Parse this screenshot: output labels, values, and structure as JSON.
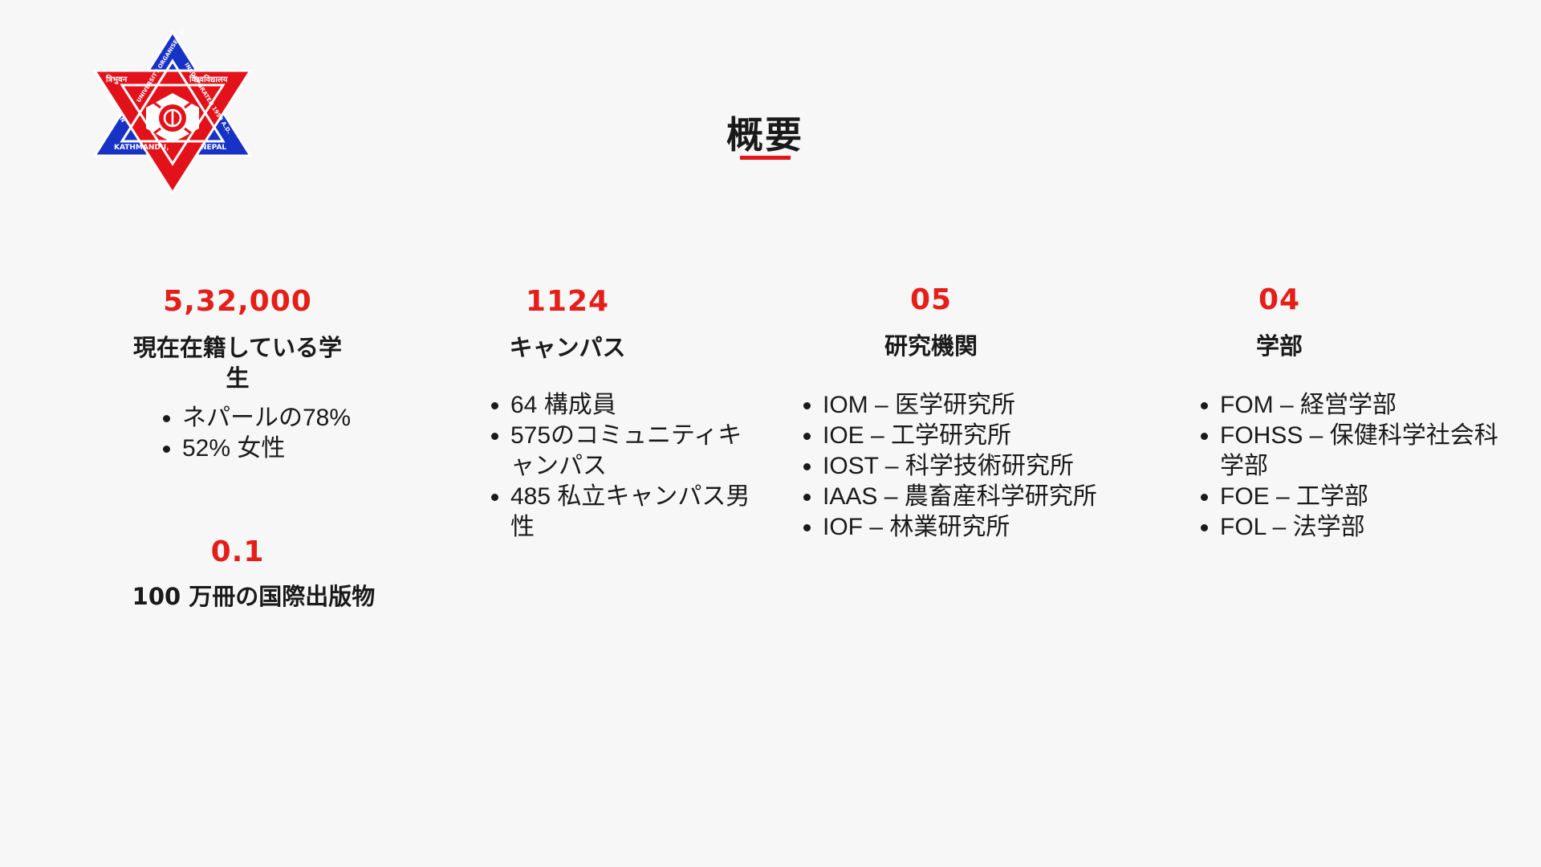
{
  "page": {
    "title": "概要"
  },
  "logo": {
    "name": "Tribhuvan University emblem",
    "text_top_left": "त्रिभुवन",
    "text_top_right": "विश्वविद्यालय",
    "text_bottom_left": "KATHMANDU,",
    "text_bottom_right": "NEPAL",
    "text_band_1": "UNIVERSITY ORGANISED 1959 A.D.",
    "text_band_2": "INCORPORATED 1959 A.D.",
    "text_band_3": "TRIBHUVAN",
    "colors": {
      "red": "#e3121a",
      "blue": "#1733c6",
      "white": "#ffffff"
    }
  },
  "stats": [
    {
      "value": "5,32,000",
      "label_line1": "現在在籍している学",
      "label_line2": "生",
      "items": [
        "ネパールの78%",
        "52% 女性"
      ]
    },
    {
      "value": "1124",
      "label": "キャンパス",
      "items": [
        "64 構成員",
        "575のコミュニティキ",
        "ャンパス",
        "485 私立キャンパス男",
        "性"
      ]
    },
    {
      "value": "05",
      "label": "研究機関",
      "items": [
        "IOM – 医学研究所",
        "IOE – 工学研究所",
        "IOST – 科学技術研究所",
        "IAAS – 農畜産科学研究所",
        "IOF – 林業研究所"
      ]
    },
    {
      "value": "04",
      "label": "学部",
      "items": [
        "FOM – 経営学部",
        "FOHSS – 保健科学社会科",
        "学部",
        "FOE – 工学部",
        "FOL – 法学部"
      ]
    },
    {
      "value": "0.1",
      "label": "100 万冊の国際出版物"
    }
  ],
  "colors": {
    "accent": "#e41f1a",
    "background": "#f7f7f7",
    "text": "#1a1a1a"
  }
}
